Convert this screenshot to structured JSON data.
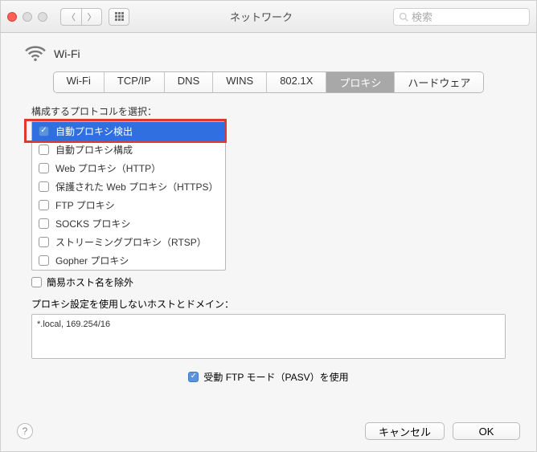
{
  "window": {
    "title": "ネットワーク"
  },
  "search": {
    "placeholder": "検索"
  },
  "header": {
    "title": "Wi-Fi"
  },
  "tabs": [
    {
      "label": "Wi-Fi",
      "active": false
    },
    {
      "label": "TCP/IP",
      "active": false
    },
    {
      "label": "DNS",
      "active": false
    },
    {
      "label": "WINS",
      "active": false
    },
    {
      "label": "802.1X",
      "active": false
    },
    {
      "label": "プロキシ",
      "active": true
    },
    {
      "label": "ハードウェア",
      "active": false
    }
  ],
  "protocol_section_label": "構成するプロトコルを選択：",
  "protocols": [
    {
      "label": "自動プロキシ検出",
      "checked": true,
      "selected": true
    },
    {
      "label": "自動プロキシ構成",
      "checked": false,
      "selected": false
    },
    {
      "label": "Web プロキシ（HTTP）",
      "checked": false,
      "selected": false
    },
    {
      "label": "保護された Web プロキシ（HTTPS）",
      "checked": false,
      "selected": false
    },
    {
      "label": "FTP プロキシ",
      "checked": false,
      "selected": false
    },
    {
      "label": "SOCKS プロキシ",
      "checked": false,
      "selected": false
    },
    {
      "label": "ストリーミングプロキシ（RTSP）",
      "checked": false,
      "selected": false
    },
    {
      "label": "Gopher プロキシ",
      "checked": false,
      "selected": false
    }
  ],
  "simple_hostnames": {
    "label": "簡易ホスト名を除外",
    "checked": false
  },
  "bypass": {
    "label": "プロキシ設定を使用しないホストとドメイン：",
    "value": "*.local, 169.254/16"
  },
  "pasv": {
    "label": "受動 FTP モード（PASV）を使用",
    "checked": true
  },
  "buttons": {
    "cancel": "キャンセル",
    "ok": "OK"
  }
}
